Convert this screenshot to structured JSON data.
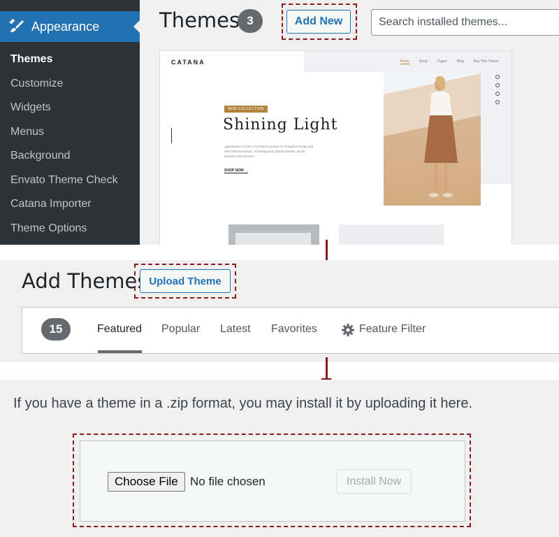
{
  "sidebar": {
    "header_label": "Appearance",
    "header_icon": "paintbrush-icon",
    "items": [
      {
        "label": "Themes",
        "current": true
      },
      {
        "label": "Customize"
      },
      {
        "label": "Widgets"
      },
      {
        "label": "Menus"
      },
      {
        "label": "Background"
      },
      {
        "label": "Envato Theme Check"
      },
      {
        "label": "Catana Importer"
      },
      {
        "label": "Theme Options"
      }
    ]
  },
  "themes_page": {
    "title": "Themes",
    "count": "3",
    "add_new_label": "Add New",
    "search_placeholder": "Search installed themes...",
    "preview": {
      "logo": "CATANA",
      "nav": [
        "Home",
        "Shop",
        "Pages",
        "Blog",
        "Buy This Theme"
      ],
      "tag": "NEW COLLECTION",
      "heading": "Shining Light",
      "description": "Appropriate is a form of a shared passion for thoughtful design and well-crafted products. Unambiguously distinguishable, gentle, beloved minimal items.",
      "cta": "SHOP NOW →"
    }
  },
  "add_themes_page": {
    "title": "Add Themes",
    "upload_label": "Upload Theme",
    "count": "15",
    "tabs": [
      "Featured",
      "Popular",
      "Latest",
      "Favorites"
    ],
    "active_tab": "Featured",
    "feature_filter_label": "Feature Filter"
  },
  "upload_section": {
    "description": "If you have a theme in a .zip format, you may install it by uploading it here.",
    "choose_file_label": "Choose File",
    "no_file_label": "No file chosen",
    "install_label": "Install Now"
  },
  "colors": {
    "wp_blue": "#2271b1",
    "sidebar_bg": "#2c3338",
    "highlight_dashed": "#8b1a1a",
    "badge_grey": "#646970"
  }
}
